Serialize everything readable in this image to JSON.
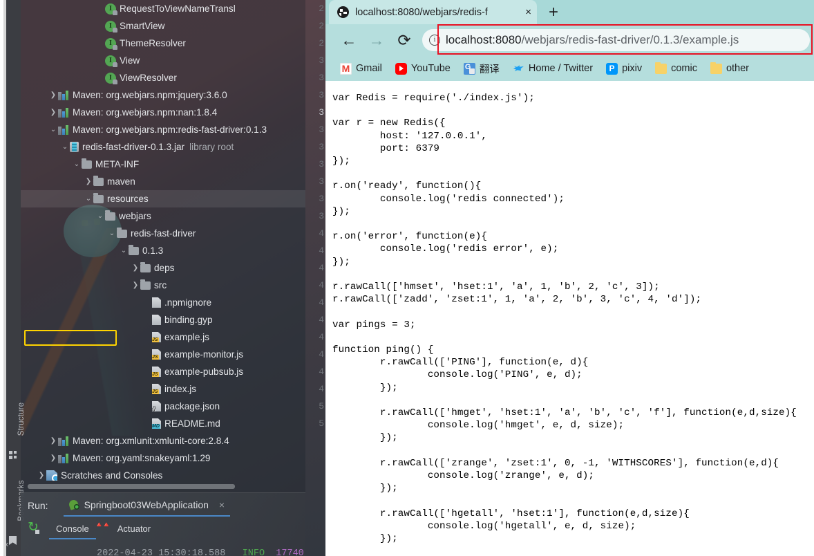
{
  "ide": {
    "stripe": {
      "structure_label": "Structure",
      "bookmarks_label": "Bookmarks",
      "collapse_glyph": "‹"
    },
    "tree": [
      {
        "indent": 6,
        "arrow": "",
        "icon": "interface",
        "label": "RequestToViewNameTransl",
        "selected": false
      },
      {
        "indent": 6,
        "arrow": "",
        "icon": "interface",
        "label": "SmartView",
        "selected": false
      },
      {
        "indent": 6,
        "arrow": "",
        "icon": "interface",
        "label": "ThemeResolver",
        "selected": false
      },
      {
        "indent": 6,
        "arrow": "",
        "icon": "interface",
        "label": "View",
        "selected": false
      },
      {
        "indent": 6,
        "arrow": "",
        "icon": "interface",
        "label": "ViewResolver",
        "selected": false
      },
      {
        "indent": 2,
        "arrow": "collapsed",
        "icon": "maven",
        "label": "Maven: org.webjars.npm:jquery:3.6.0",
        "selected": false
      },
      {
        "indent": 2,
        "arrow": "collapsed",
        "icon": "maven",
        "label": "Maven: org.webjars.npm:nan:1.8.4",
        "selected": false
      },
      {
        "indent": 2,
        "arrow": "expanded",
        "icon": "maven",
        "label": "Maven: org.webjars.npm:redis-fast-driver:0.1.3",
        "selected": false
      },
      {
        "indent": 3,
        "arrow": "expanded",
        "icon": "jar",
        "label": "redis-fast-driver-0.1.3.jar",
        "suffix": "library root",
        "selected": false
      },
      {
        "indent": 4,
        "arrow": "expanded",
        "icon": "folder",
        "label": "META-INF",
        "selected": false
      },
      {
        "indent": 5,
        "arrow": "collapsed",
        "icon": "folder",
        "label": "maven",
        "selected": false
      },
      {
        "indent": 5,
        "arrow": "expanded",
        "icon": "folder",
        "label": "resources",
        "selected": true
      },
      {
        "indent": 6,
        "arrow": "expanded",
        "icon": "folder",
        "label": "webjars",
        "selected": false
      },
      {
        "indent": 7,
        "arrow": "expanded",
        "icon": "folder",
        "label": "redis-fast-driver",
        "selected": false
      },
      {
        "indent": 8,
        "arrow": "expanded",
        "icon": "folder",
        "label": "0.1.3",
        "selected": false
      },
      {
        "indent": 9,
        "arrow": "collapsed",
        "icon": "folder",
        "label": "deps",
        "selected": false
      },
      {
        "indent": 9,
        "arrow": "collapsed",
        "icon": "folder",
        "label": "src",
        "selected": false
      },
      {
        "indent": 10,
        "arrow": "",
        "icon": "file",
        "label": ".npmignore",
        "selected": false
      },
      {
        "indent": 10,
        "arrow": "",
        "icon": "file",
        "label": "binding.gyp",
        "selected": false
      },
      {
        "indent": 10,
        "arrow": "",
        "icon": "file-js",
        "label": "example.js",
        "selected": false,
        "highlighted": true
      },
      {
        "indent": 10,
        "arrow": "",
        "icon": "file-js",
        "label": "example-monitor.js",
        "selected": false
      },
      {
        "indent": 10,
        "arrow": "",
        "icon": "file-js",
        "label": "example-pubsub.js",
        "selected": false
      },
      {
        "indent": 10,
        "arrow": "",
        "icon": "file-js",
        "label": "index.js",
        "selected": false
      },
      {
        "indent": 10,
        "arrow": "",
        "icon": "file-json",
        "label": "package.json",
        "selected": false
      },
      {
        "indent": 10,
        "arrow": "",
        "icon": "file-md",
        "label": "README.md",
        "selected": false
      },
      {
        "indent": 2,
        "arrow": "collapsed",
        "icon": "maven",
        "label": "Maven: org.xmlunit:xmlunit-core:2.8.4",
        "selected": false
      },
      {
        "indent": 2,
        "arrow": "collapsed",
        "icon": "maven",
        "label": "Maven: org.yaml:snakeyaml:1.29",
        "selected": false
      },
      {
        "indent": 1,
        "arrow": "collapsed",
        "icon": "scratch",
        "label": "Scratches and Consoles",
        "selected": false
      }
    ],
    "gutter_line_numbers": [
      "2",
      "2",
      "2",
      "3",
      "3",
      "3",
      "3",
      "3",
      "3",
      "3",
      "3",
      "3",
      "3",
      "4",
      "4",
      "4",
      "4",
      "4",
      "4",
      "4",
      "4",
      "4",
      "4",
      "5",
      "5"
    ],
    "run": {
      "label": "Run:",
      "config_name": "Springboot03WebApplication",
      "close_glyph": "×",
      "tabs": [
        {
          "label": "Console",
          "active": true
        },
        {
          "label": "Actuator",
          "active": false
        }
      ],
      "console_timestamp": "2022-04-23 15:30:18.588",
      "console_level": "INFO",
      "console_pid": "17740"
    }
  },
  "browser": {
    "tab": {
      "title": "localhost:8080/webjars/redis-f",
      "close_glyph": "×",
      "newtab_glyph": "+"
    },
    "toolbar": {
      "back_glyph": "←",
      "forward_glyph": "→",
      "reload_glyph": "⟳",
      "info_glyph": "i",
      "url_host": "localhost:8080",
      "url_path": "/webjars/redis-fast-driver/0.1.3/example.js"
    },
    "bookmarks": [
      {
        "label": "Gmail",
        "icon": "gmail-icon"
      },
      {
        "label": "YouTube",
        "icon": "youtube-icon"
      },
      {
        "label": "翻译",
        "icon": "google-translate-icon"
      },
      {
        "label": "Home / Twitter",
        "icon": "twitter-icon"
      },
      {
        "label": "pixiv",
        "icon": "pixiv-icon"
      },
      {
        "label": "comic",
        "icon": "folder-icon"
      },
      {
        "label": "other",
        "icon": "folder-icon"
      }
    ],
    "page_code": "var Redis = require('./index.js');\n\nvar r = new Redis({\n        host: '127.0.0.1',\n        port: 6379\n});\n\nr.on('ready', function(){\n        console.log('redis connected');\n});\n\nr.on('error', function(e){\n        console.log('redis error', e);\n});\n\nr.rawCall(['hmset', 'hset:1', 'a', 1, 'b', 2, 'c', 3]);\nr.rawCall(['zadd', 'zset:1', 1, 'a', 2, 'b', 3, 'c', 4, 'd']);\n\nvar pings = 3;\n\nfunction ping() {\n        r.rawCall(['PING'], function(e, d){\n                console.log('PING', e, d);\n        });\n\n        r.rawCall(['hmget', 'hset:1', 'a', 'b', 'c', 'f'], function(e,d,size){\n                console.log('hmget', e, d, size);\n        });\n\n        r.rawCall(['zrange', 'zset:1', 0, -1, 'WITHSCORES'], function(e,d){\n                console.log('zrange', e, d);\n        });\n\n        r.rawCall(['hgetall', 'hset:1'], function(e,d,size){\n                console.log('hgetall', e, d, size);\n        });"
  },
  "colors": {
    "browser_chrome": "#b5dedd",
    "tab_active": "#c7e7e6",
    "highlight_yellow": "#ffd400",
    "highlight_red": "#e81123",
    "ide_bg": "#3c3f41"
  }
}
